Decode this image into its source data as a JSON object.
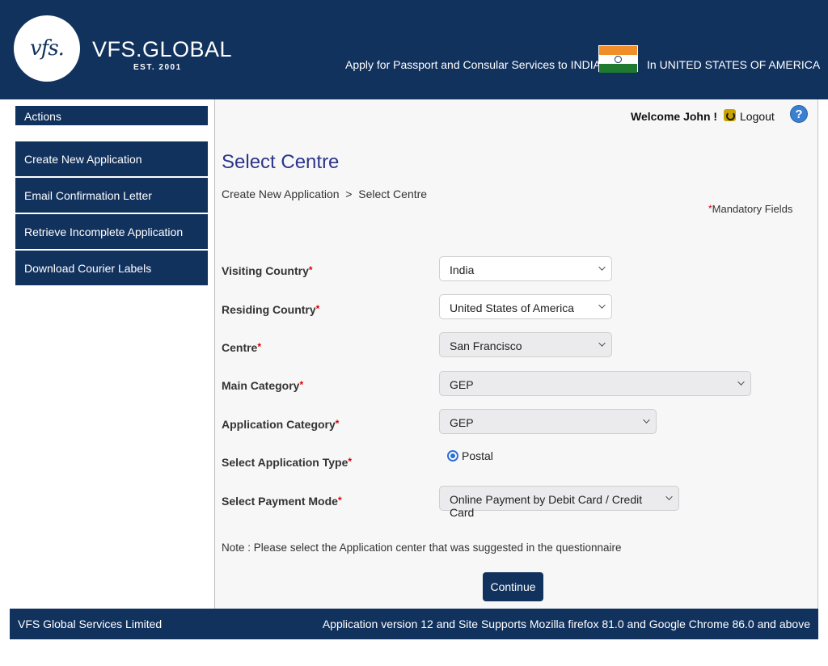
{
  "header": {
    "logo_text": "vfs.",
    "brand": "VFS.GLOBAL",
    "brand_est": "EST. 2001",
    "tagline": "Apply for Passport and Consular Services to INDIA",
    "country": "In UNITED STATES OF AMERICA",
    "flag_icon": "india-flag-icon"
  },
  "sidebar": {
    "title": "Actions",
    "items": [
      {
        "label": "Create New Application"
      },
      {
        "label": "Email Confirmation Letter"
      },
      {
        "label": "Retrieve Incomplete Application"
      },
      {
        "label": "Download Courier Labels"
      }
    ]
  },
  "topbar": {
    "welcome": "Welcome John !",
    "logout": "Logout",
    "help": "?"
  },
  "main": {
    "title": "Select Centre",
    "breadcrumb": "Create New Application  >  Select Centre",
    "mandatory_star": "*",
    "mandatory": "Mandatory Fields",
    "fields": {
      "visiting_country": {
        "label": "Visiting Country",
        "value": "India"
      },
      "residing_country": {
        "label": "Residing Country",
        "value": "United States of America"
      },
      "centre": {
        "label": "Centre",
        "value": "San Francisco"
      },
      "main_category": {
        "label": "Main Category",
        "value": "GEP"
      },
      "application_category": {
        "label": "Application Category",
        "value": "GEP"
      },
      "application_type": {
        "label": "Select Application Type",
        "value": "Postal"
      },
      "payment_mode": {
        "label": "Select Payment Mode",
        "value": "Online Payment by Debit Card / Credit Card"
      }
    },
    "note": "Note : Please select the Application center that was suggested in the questionnaire",
    "continue": "Continue"
  },
  "footer": {
    "left": "VFS Global Services Limited",
    "right": "Application version 12 and Site Supports Mozilla firefox 81.0 and Google Chrome 86.0 and above"
  },
  "colors": {
    "navy": "#12325e",
    "title": "#2c3589",
    "required": "#d40000"
  }
}
